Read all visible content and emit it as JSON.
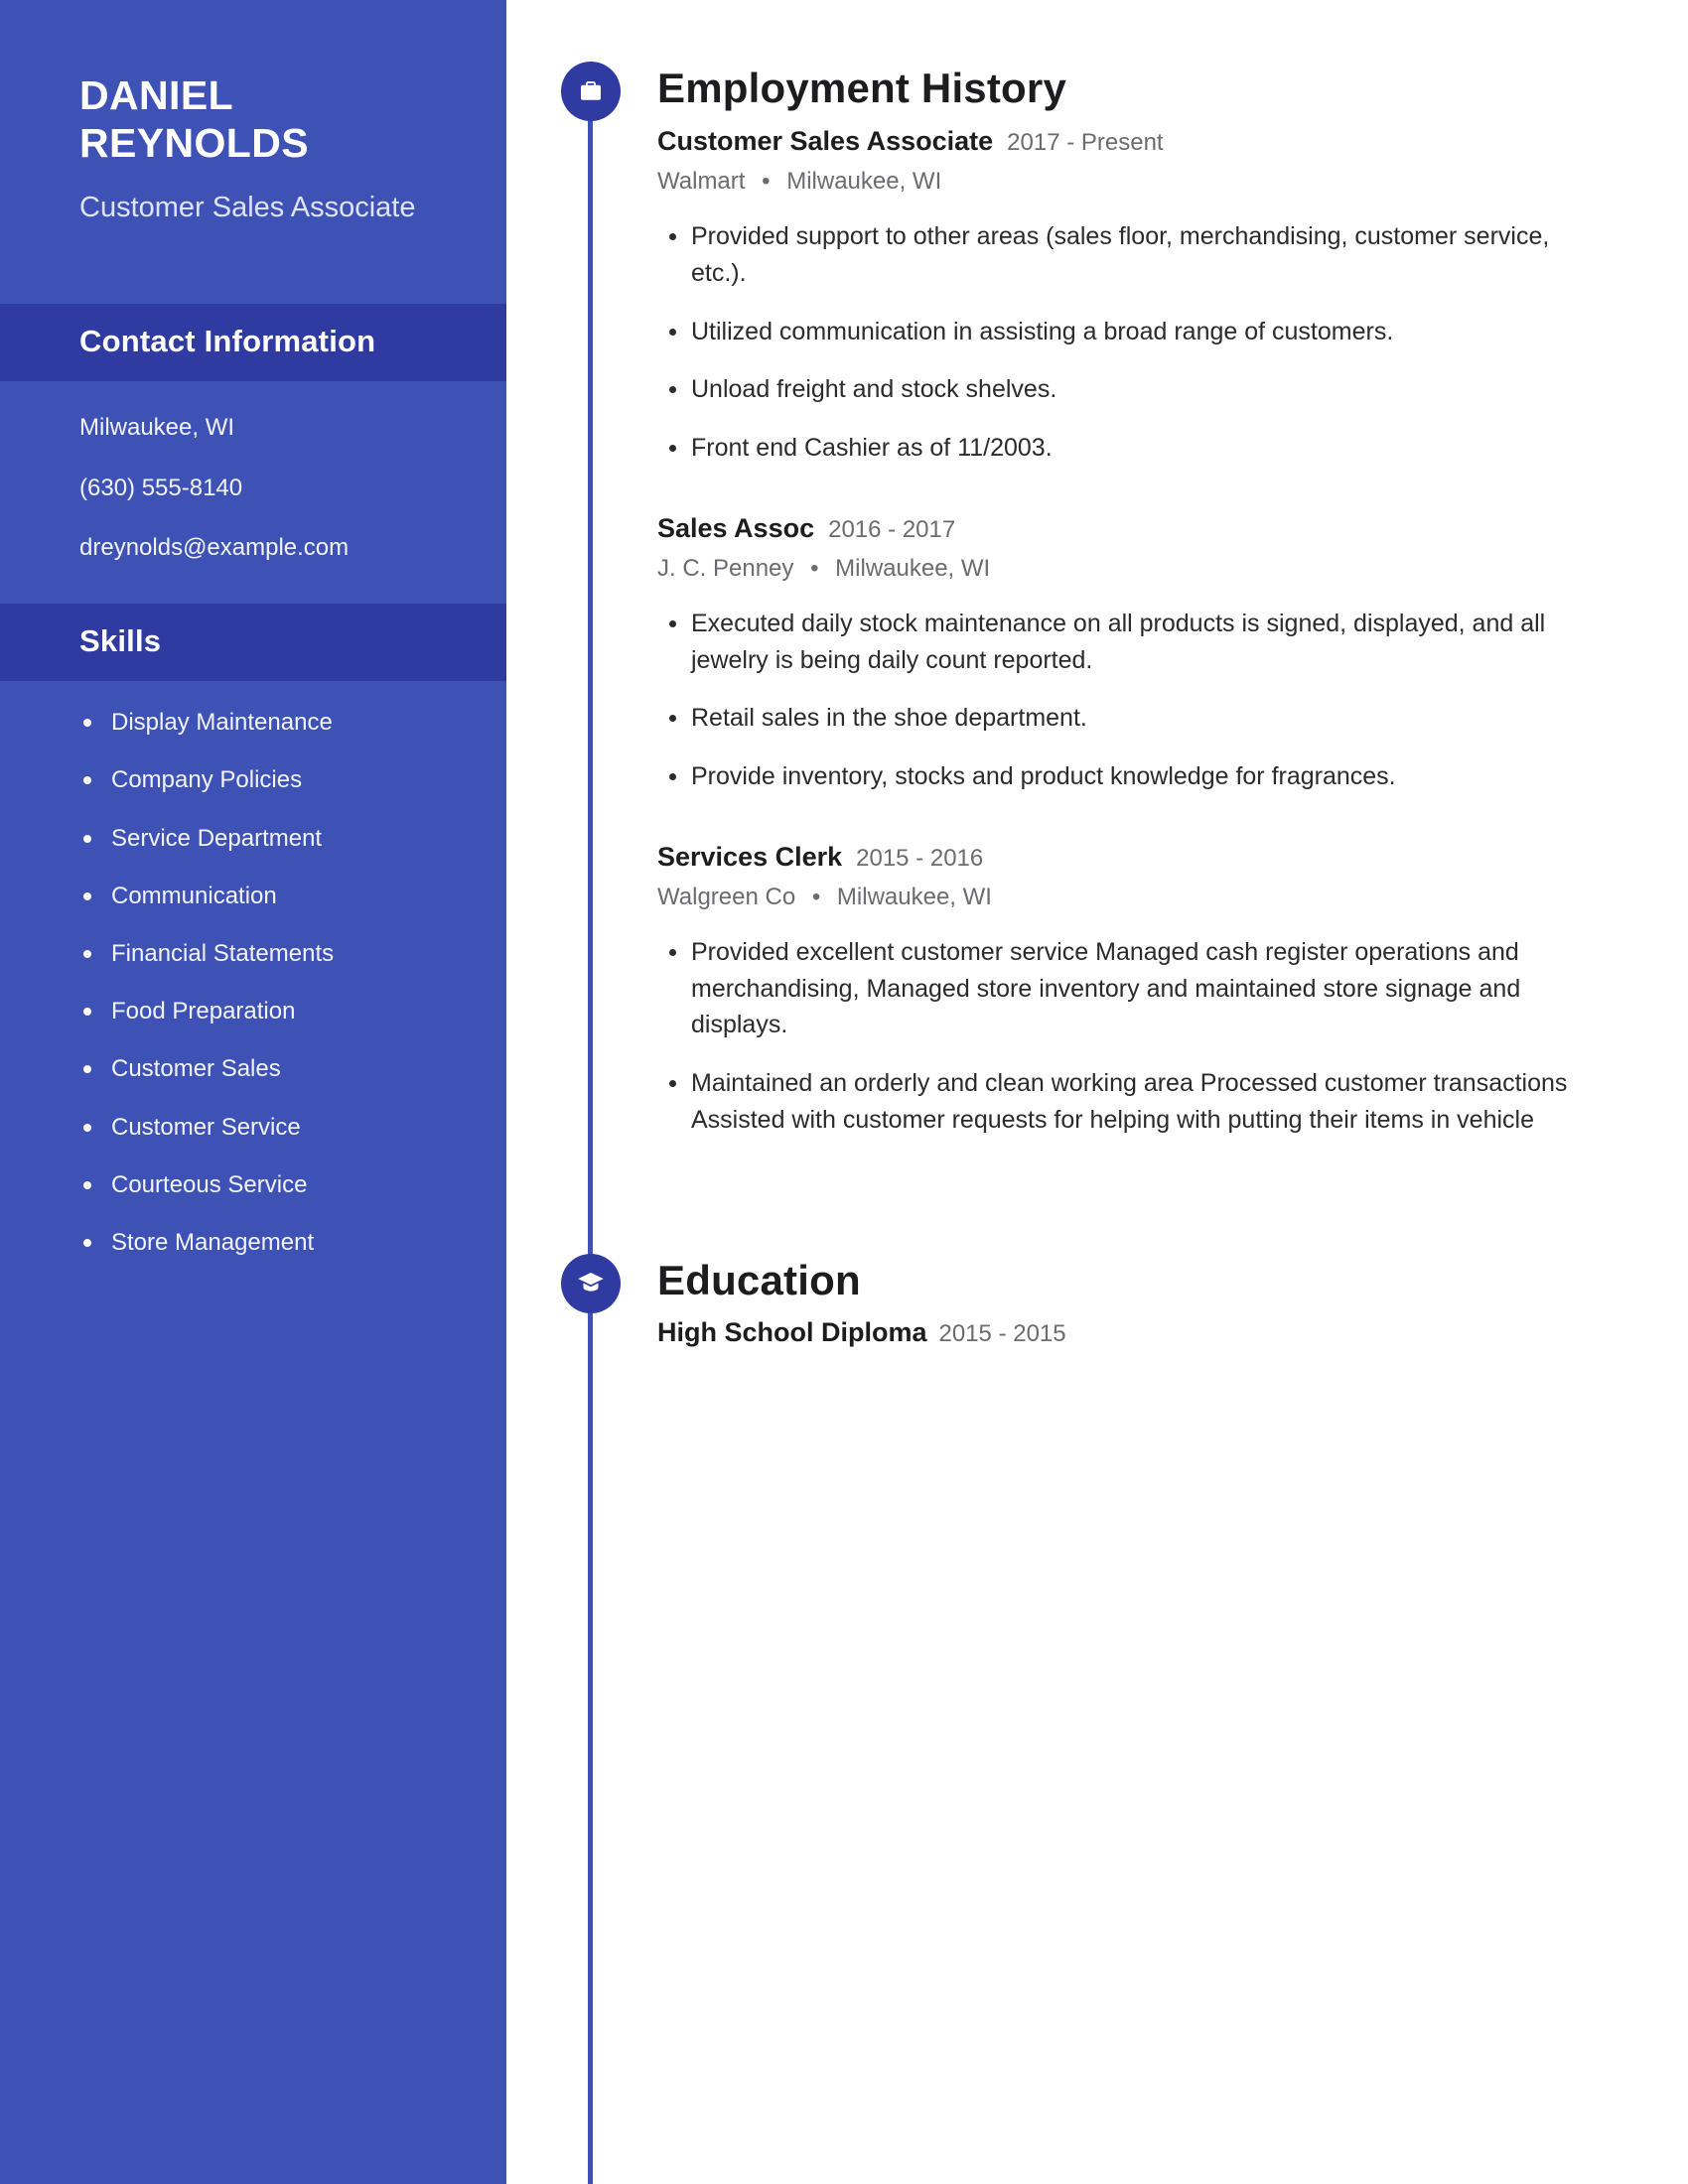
{
  "sidebar": {
    "first_name": "DANIEL",
    "last_name": "REYNOLDS",
    "job_title": "Customer Sales Associate",
    "contact": {
      "heading": "Contact Information",
      "location": "Milwaukee, WI",
      "phone": "(630) 555-8140",
      "email": "dreynolds@example.com"
    },
    "skills": {
      "heading": "Skills",
      "items": [
        "Display Maintenance",
        "Company Policies",
        "Service Department",
        "Communication",
        "Financial Statements",
        "Food Preparation",
        "Customer Sales",
        "Customer Service",
        "Courteous Service",
        "Store Management"
      ]
    }
  },
  "main": {
    "employment": {
      "title": "Employment History",
      "icon": "briefcase-icon",
      "entries": [
        {
          "role": "Customer Sales Associate",
          "dates": "2017 - Present",
          "company": "Walmart",
          "location": "Milwaukee, WI",
          "bullets": [
            "Provided support to other areas (sales floor, merchandising, customer service, etc.).",
            "Utilized communication in assisting a broad range of customers.",
            "Unload freight and stock shelves.",
            "Front end Cashier as of 11/2003."
          ]
        },
        {
          "role": "Sales Assoc",
          "dates": "2016 - 2017",
          "company": "J. C. Penney",
          "location": "Milwaukee, WI",
          "bullets": [
            "Executed daily stock maintenance on all products is signed, displayed, and all jewelry is being daily count reported.",
            "Retail sales in the shoe department.",
            "Provide inventory, stocks and product knowledge for fragrances."
          ]
        },
        {
          "role": "Services Clerk",
          "dates": "2015 - 2016",
          "company": "Walgreen Co",
          "location": "Milwaukee, WI",
          "bullets": [
            "Provided excellent customer service Managed cash register operations and merchandising, Managed store inventory and maintained store signage and displays.",
            "Maintained an orderly and clean working area Processed customer transactions Assisted with customer requests for helping with putting their items in vehicle"
          ]
        }
      ]
    },
    "education": {
      "title": "Education",
      "icon": "graduation-cap-icon",
      "entries": [
        {
          "degree": "High School Diploma",
          "dates": "2015 - 2015"
        }
      ]
    }
  },
  "separator": "•",
  "colors": {
    "sidebar_bg": "#3e51b5",
    "sidebar_band_bg": "#2f3ba0",
    "accent": "#2f3ba0",
    "text_dark": "#1d1d1f",
    "text_muted": "#6b6b70",
    "text_light": "#f2f4fd"
  }
}
